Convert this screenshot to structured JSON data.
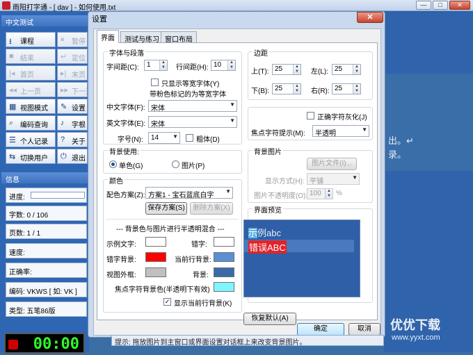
{
  "window": {
    "title": "雨阳打字通 - [ dav ] - 如何使用.txt"
  },
  "left": {
    "section_title": "中文测试",
    "buttons": [
      {
        "label": "课程",
        "icon": "down-arrow-icon",
        "enabled": true
      },
      {
        "label": "暂停",
        "icon": "pause-icon",
        "enabled": false
      },
      {
        "label": "结束",
        "icon": "stop-icon",
        "enabled": false
      },
      {
        "label": "定位",
        "icon": "locate-icon",
        "enabled": false
      },
      {
        "label": "首页",
        "icon": "first-page-icon",
        "enabled": false
      },
      {
        "label": "末页",
        "icon": "last-page-icon",
        "enabled": false
      },
      {
        "label": "上一页",
        "icon": "prev-page-icon",
        "enabled": false
      },
      {
        "label": "下一页",
        "icon": "next-page-icon",
        "enabled": false
      },
      {
        "label": "视图模式",
        "icon": "view-mode-icon",
        "enabled": true
      },
      {
        "label": "设置",
        "icon": "wrench-icon",
        "enabled": true
      },
      {
        "label": "编码查询",
        "icon": "search-icon",
        "enabled": true
      },
      {
        "label": "字根",
        "icon": "radical-icon",
        "enabled": true
      },
      {
        "label": "个人记录",
        "icon": "list-icon",
        "enabled": true
      },
      {
        "label": "关于",
        "icon": "help-icon",
        "enabled": true
      },
      {
        "label": "切换用户",
        "icon": "switch-user-icon",
        "enabled": true
      },
      {
        "label": "退出",
        "icon": "exit-icon",
        "enabled": true
      }
    ],
    "info_title": "信息",
    "info": {
      "progress": "进度:",
      "chars": "字数: 0 / 106",
      "pages": "页数: 1 / 1",
      "speed": "速度:",
      "accuracy": "正确率:",
      "code": "编码: VKWS [ 如: VK ]",
      "type": "类型: 五笔86版"
    },
    "timer": "00:00"
  },
  "workspace": {
    "line1": "出。↵",
    "line2": "录。"
  },
  "dialog": {
    "title": "设置",
    "close": "✕",
    "tabs": [
      "界面",
      "测试与练习",
      "窗口布局"
    ],
    "font_group": {
      "title": "字体与段落",
      "char_spacing_label": "字间距(C):",
      "char_spacing": "1",
      "line_spacing_label": "行间距(H):",
      "line_spacing": "10",
      "monospace_only": "只显示等宽字体(Y)",
      "pinyin_note": "带粉色标记的为等宽字体",
      "cn_font_label": "中文字体(F):",
      "cn_font": "宋体",
      "en_font_label": "英文字体(E):",
      "en_font": "宋体",
      "size_label": "字号(N):",
      "size": "14",
      "bold": "粗体(D)"
    },
    "margin_group": {
      "title": "边距",
      "top_label": "上(T):",
      "top": "25",
      "left_label": "左(L):",
      "left": "25",
      "bottom_label": "下(B):",
      "bottom": "25",
      "right_label": "右(R):",
      "right": "25"
    },
    "correct_gray": "正确字符灰化(J)",
    "focus_hint_label": "焦点字符提示(M):",
    "focus_hint": "半透明",
    "bg_use": {
      "title": "背景使用:",
      "solid": "单色(G)",
      "image": "图片(P)"
    },
    "bg_image": {
      "title": "背景图片",
      "file_button": "图片文件(I)...",
      "mode_label": "显示方式(H):",
      "mode": "平铺",
      "opacity_label": "图片不透明度(O):",
      "opacity": "100",
      "opacity_unit": "%"
    },
    "color": {
      "title": "颜色",
      "scheme_label": "配色方案(Z):",
      "scheme": "方案1 - 宝石蓝底白字",
      "save": "保存方案(S)",
      "delete": "删除方案(X)",
      "blend_note": "--- 背景色与图片进行半透明混合 ---",
      "sample_text": "示例文字:",
      "wrong_char": "错字:",
      "wrong_bg": "错字背景:",
      "current_line_bg": "当前行背景:",
      "view_frame": "视图外框:",
      "background": "背景:",
      "focus_bg": "焦点字符背景色(半透明下有效)",
      "show_current_line": "显示当前行背景(K)",
      "colors": {
        "sample_text": "#ffffff",
        "wrong_char": "#ffffff",
        "wrong_bg": "#ff0000",
        "current_line_bg": "#5b8fd4",
        "view_frame": "#c0c0c0",
        "background": "#3a6aa8",
        "focus_bg": "#7ff6ff"
      }
    },
    "preview": {
      "title": "界面预览",
      "line1_hl": "示",
      "line1_rest": "例abc",
      "line2": "错误ABC"
    },
    "restore_default": "恢复默认(A)",
    "ok": "确定",
    "cancel": "取消"
  },
  "hint": "提示: 拖放图片到主窗口或界面设置对话框上来改变背景图片。",
  "watermark": {
    "brand": "优优下载",
    "url": "www.yyxt.com"
  }
}
